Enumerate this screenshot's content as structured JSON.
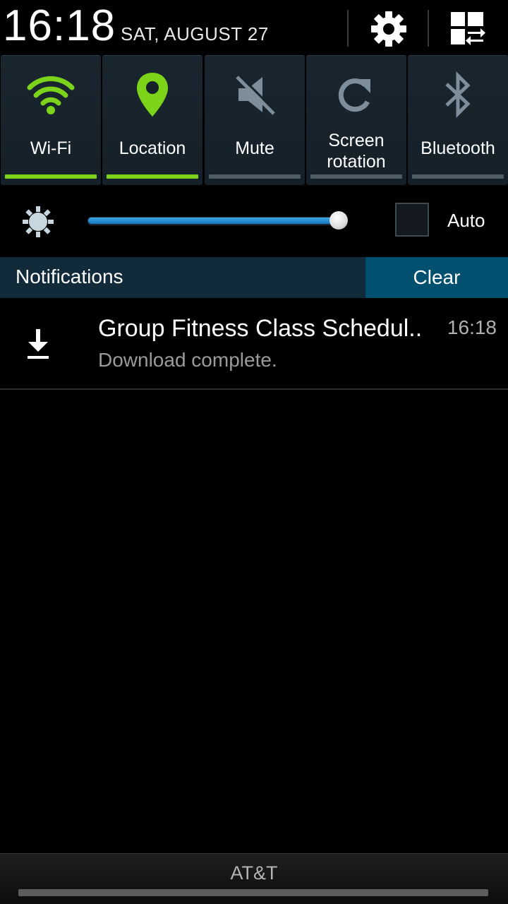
{
  "status": {
    "time": "16:18",
    "date": "SAT, AUGUST 27"
  },
  "header_icons": {
    "settings": "gear-icon",
    "edit": "grid-swap-icon"
  },
  "toggles": [
    {
      "label": "Wi-Fi",
      "icon": "wifi-icon",
      "state": "on"
    },
    {
      "label": "Location",
      "icon": "location-pin-icon",
      "state": "on"
    },
    {
      "label": "Mute",
      "icon": "mute-icon",
      "state": "off"
    },
    {
      "label": "Screen\nrotation",
      "icon": "rotate-icon",
      "state": "off"
    },
    {
      "label": "Bluetooth",
      "icon": "bluetooth-icon",
      "state": "off"
    }
  ],
  "brightness": {
    "level": 0.99,
    "auto_label": "Auto",
    "auto_checked": false
  },
  "notifications": {
    "title": "Notifications",
    "clear_label": "Clear",
    "items": [
      {
        "icon": "download-icon",
        "title": "Group Fitness Class Schedul..",
        "text": "Download complete.",
        "time": "16:18"
      }
    ]
  },
  "footer": {
    "carrier": "AT&T"
  },
  "colors": {
    "toggle_on": "#7cd319",
    "toggle_off_icon": "#7d8d99",
    "slider_fill": "#1f8bd4",
    "clear_bg": "#02506f",
    "notif_header_bg": "#122b3a"
  }
}
